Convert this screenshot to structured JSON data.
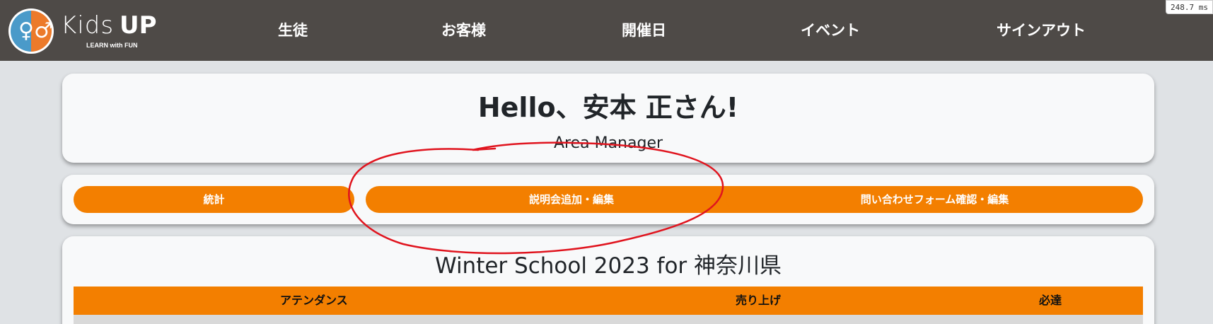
{
  "perf_overlay": "248.7 ms",
  "logo": {
    "wordmark_kids": "Kids",
    "wordmark_up": "UP",
    "tagline": "LEARN with FUN",
    "icon": "kids-figures-icon"
  },
  "nav": {
    "students": "生徒",
    "customers": "お客様",
    "dates": "開催日",
    "events": "イベント",
    "sign_out": "サインアウト"
  },
  "greeting": {
    "title": "Hello、安本 正さん!",
    "role": "Area Manager"
  },
  "actions": {
    "stats": "統計",
    "session_edit": "説明会追加・編集",
    "inquiry_form": "問い合わせフォーム確認・編集"
  },
  "event": {
    "title": "Winter School 2023 for 神奈川県",
    "columns": [
      "アテンダンス",
      "売り上げ",
      "必達"
    ]
  },
  "colors": {
    "navbar": "#4e4a47",
    "accent": "#f37f00",
    "annotation": "#e0141e"
  }
}
